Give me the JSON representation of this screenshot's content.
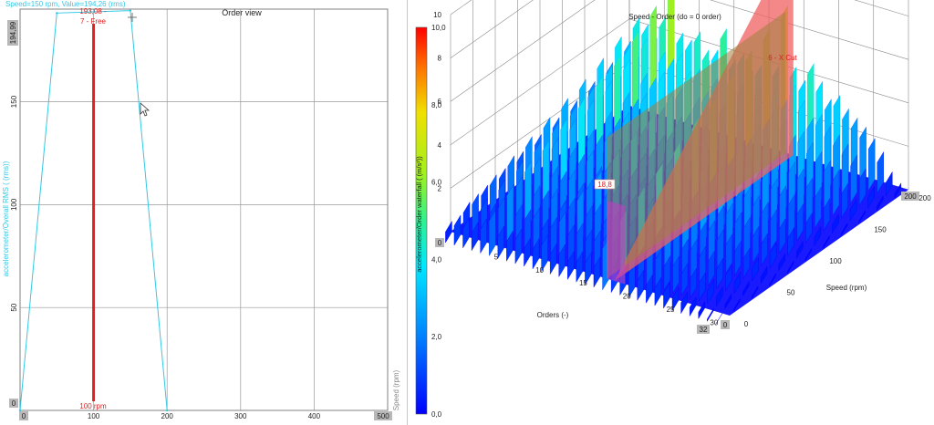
{
  "colors": {
    "accent_cyan": "#33c8e6",
    "cursor_red": "#e02020",
    "grid": "#909090",
    "tick_box": "#b8b8b8",
    "cut_plane": "#f06060"
  },
  "left_panel": {
    "title": "Order view",
    "cursor_readout": "Speed=150 rpm, Value=194,26  (rms)",
    "max_marker": "193,08 -",
    "free_label": "7 - Free",
    "cursor_value_label": "100 rpm",
    "ylabel": "accelerometer/Overall RMS  ( (rms))",
    "xlabel": "Speed (rpm)",
    "y_max_box": "194,99",
    "x_min_box": "0",
    "x_max_box": "500",
    "y_min_box": "0"
  },
  "right_panel": {
    "title": "Speed - Order (do = 0 order)",
    "cut_label": "6 - X Cut",
    "cursor_value_box": "18,8",
    "colorbar_label": "accelerometer/Order waterfall ( (m/s²))",
    "colorbar_ticks": [
      "10,0",
      "8,0",
      "6,0",
      "4,0",
      "2,0",
      "0,0"
    ],
    "z_axis_ticks": [
      "10",
      "8",
      "6",
      "4",
      "2",
      "0"
    ],
    "z_axis_bottom_box": "0",
    "orders_label": "Orders (-)",
    "orders_ticks": [
      "5",
      "10",
      "15",
      "20",
      "25",
      "30"
    ],
    "orders_max_box": "32",
    "speed_label": "Speed (rpm)",
    "speed_ticks": [
      "0",
      "50",
      "100",
      "150",
      "200"
    ],
    "speed_max_box": "200",
    "speed_min_box": "0"
  },
  "chart_data": [
    {
      "type": "line",
      "title": "Order view",
      "xlabel": "Speed (rpm)",
      "ylabel": "accelerometer/Overall RMS  ( (rms))",
      "xlim": [
        0,
        500
      ],
      "ylim": [
        0,
        194.99
      ],
      "x_ticks": [
        0,
        100,
        200,
        300,
        400,
        500
      ],
      "y_ticks": [
        0,
        50,
        100,
        150
      ],
      "grid": true,
      "series": [
        {
          "x": [
            0,
            50,
            150,
            200
          ],
          "y": [
            0,
            193.08,
            194.26,
            0
          ]
        }
      ],
      "cursor": {
        "x": 100,
        "label": "100 rpm"
      },
      "annotations": [
        "Speed=150 rpm, Value=194,26  (rms)",
        "193,08 -",
        "7 - Free"
      ]
    },
    {
      "type": "heatmap",
      "title": "Speed - Order (do = 0 order)",
      "xlabel": "Orders (-)",
      "ylabel": "Speed (rpm)",
      "zlabel": "accelerometer/Order waterfall ( (m/s²))",
      "xlim": [
        0,
        32
      ],
      "ylim": [
        0,
        200
      ],
      "zlim": [
        0,
        10
      ],
      "x_ticks": [
        5,
        10,
        15,
        20,
        25,
        30
      ],
      "y_ticks": [
        0,
        50,
        100,
        150,
        200
      ],
      "colorbar_ticks": [
        0,
        2,
        4,
        6,
        8,
        10
      ],
      "x_cut": {
        "order": 18.8,
        "label": "6 - X Cut"
      },
      "series": [
        {
          "speed": 200,
          "values": [
            3.0,
            4.2,
            4.0,
            3.5,
            4.6,
            6.2,
            4.1,
            3.9,
            4.4,
            3.2,
            3.8,
            4.9,
            3.6,
            4.0,
            3.3,
            3.7,
            4.2,
            3.9,
            6.8,
            4.1,
            3.6,
            4.5,
            3.8,
            3.1,
            3.4,
            2.9,
            2.6,
            2.3,
            1.9,
            1.4,
            0.6,
            0.2
          ]
        },
        {
          "speed": 180,
          "values": [
            2.6,
            3.9,
            3.6,
            3.2,
            4.2,
            5.8,
            3.8,
            3.6,
            4.0,
            3.0,
            3.5,
            4.5,
            3.3,
            3.7,
            3.0,
            3.4,
            3.9,
            3.6,
            6.3,
            3.8,
            3.3,
            4.1,
            3.5,
            2.8,
            3.1,
            2.7,
            2.4,
            2.1,
            1.7,
            1.2,
            0.5,
            0.2
          ]
        },
        {
          "speed": 160,
          "values": [
            2.3,
            3.5,
            3.3,
            2.9,
            3.8,
            5.2,
            3.4,
            3.3,
            3.7,
            2.7,
            3.2,
            4.1,
            3.0,
            3.4,
            2.8,
            3.1,
            3.6,
            3.3,
            5.9,
            3.5,
            3.0,
            3.8,
            3.2,
            2.6,
            2.9,
            2.5,
            2.2,
            1.9,
            1.6,
            1.1,
            0.5,
            0.1
          ]
        },
        {
          "speed": 140,
          "values": [
            2.0,
            3.1,
            2.9,
            2.6,
            3.4,
            4.7,
            3.1,
            2.9,
            3.3,
            2.4,
            2.9,
            3.7,
            2.7,
            3.0,
            2.5,
            2.8,
            3.2,
            3.0,
            5.4,
            3.1,
            2.7,
            3.4,
            2.9,
            2.3,
            2.6,
            2.2,
            2.0,
            1.7,
            1.4,
            1.0,
            0.4,
            0.1
          ]
        },
        {
          "speed": 120,
          "values": [
            1.8,
            2.8,
            2.6,
            2.3,
            3.1,
            4.3,
            2.8,
            2.6,
            3.0,
            2.2,
            2.6,
            3.4,
            2.4,
            2.7,
            2.3,
            2.5,
            2.9,
            2.7,
            4.9,
            2.8,
            2.4,
            3.1,
            2.6,
            2.1,
            2.3,
            2.0,
            1.8,
            1.5,
            1.2,
            0.9,
            0.4,
            0.1
          ]
        },
        {
          "speed": 100,
          "values": [
            1.6,
            2.5,
            2.4,
            2.1,
            2.8,
            3.9,
            2.5,
            2.4,
            2.7,
            2.0,
            2.4,
            3.1,
            2.2,
            2.5,
            2.1,
            2.3,
            2.6,
            2.4,
            4.5,
            2.6,
            2.2,
            2.8,
            2.4,
            1.9,
            2.1,
            1.8,
            1.6,
            1.4,
            1.1,
            0.8,
            0.3,
            0.1
          ]
        },
        {
          "speed": 80,
          "values": [
            1.4,
            2.2,
            2.1,
            1.9,
            2.5,
            3.5,
            2.3,
            2.1,
            2.4,
            1.8,
            2.1,
            2.8,
            2.0,
            2.2,
            1.9,
            2.1,
            2.3,
            2.2,
            4.0,
            2.3,
            2.0,
            2.5,
            2.1,
            1.7,
            1.9,
            1.6,
            1.5,
            1.2,
            1.0,
            0.7,
            0.3,
            0.1
          ]
        },
        {
          "speed": 60,
          "values": [
            1.2,
            1.9,
            1.8,
            1.6,
            2.2,
            3.1,
            2.0,
            1.9,
            2.1,
            1.6,
            1.9,
            2.4,
            1.7,
            2.0,
            1.7,
            1.8,
            2.0,
            1.9,
            3.6,
            2.0,
            1.7,
            2.2,
            1.9,
            1.5,
            1.7,
            1.4,
            1.3,
            1.1,
            0.9,
            0.6,
            0.3,
            0.1
          ]
        },
        {
          "speed": 40,
          "values": [
            1.0,
            1.6,
            1.5,
            1.4,
            1.9,
            2.7,
            1.7,
            1.6,
            1.8,
            1.4,
            1.6,
            2.1,
            1.5,
            1.7,
            1.4,
            1.6,
            1.7,
            1.6,
            3.1,
            1.7,
            1.5,
            1.9,
            1.6,
            1.3,
            1.4,
            1.2,
            1.1,
            0.9,
            0.7,
            0.5,
            0.2,
            0.1
          ]
        },
        {
          "speed": 20,
          "values": [
            0.8,
            1.3,
            1.2,
            1.1,
            1.5,
            2.2,
            1.4,
            1.3,
            1.5,
            1.1,
            1.3,
            1.7,
            1.2,
            1.4,
            1.2,
            1.3,
            1.4,
            1.3,
            2.6,
            1.4,
            1.2,
            1.5,
            1.3,
            1.1,
            1.2,
            1.0,
            0.9,
            0.8,
            0.6,
            0.4,
            0.2,
            0.1
          ]
        },
        {
          "speed": 0,
          "values": [
            0.5,
            0.9,
            0.9,
            0.8,
            1.1,
            1.6,
            1.0,
            0.9,
            1.1,
            0.8,
            0.9,
            1.2,
            0.9,
            1.0,
            0.8,
            0.9,
            1.0,
            0.9,
            1.9,
            1.0,
            0.9,
            1.1,
            0.9,
            0.8,
            0.8,
            0.7,
            0.6,
            0.5,
            0.4,
            0.3,
            0.1,
            0.0
          ]
        }
      ]
    }
  ]
}
